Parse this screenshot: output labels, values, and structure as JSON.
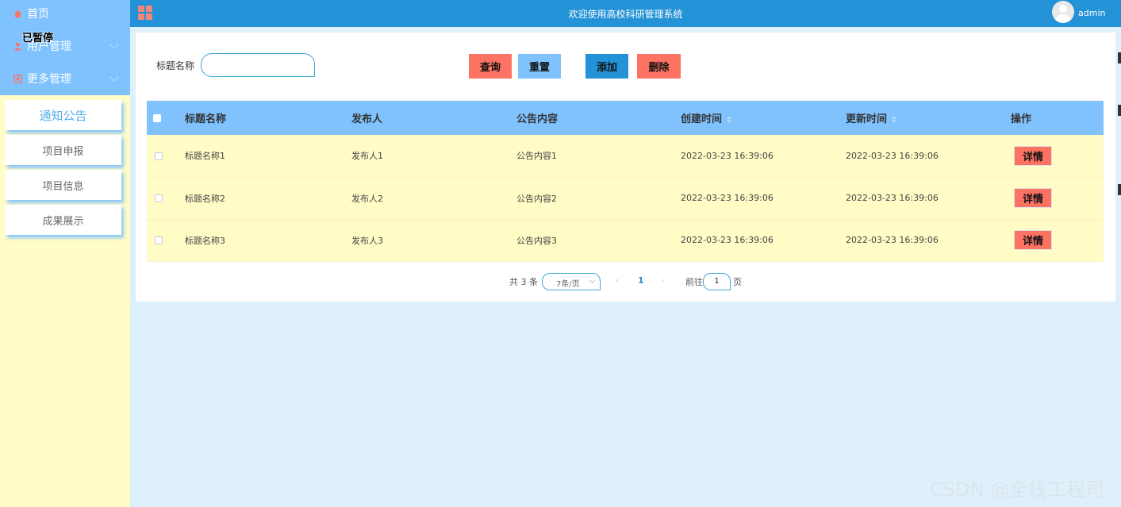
{
  "sidebar": {
    "top_items": [
      {
        "label": "首页",
        "icon": "home-icon"
      },
      {
        "label": "用户管理",
        "icon": "user-icon"
      },
      {
        "label": "更多管理",
        "icon": "more-icon"
      }
    ],
    "overlay_text": "已暂停",
    "sub_items": [
      {
        "label": "通知公告",
        "active": true
      },
      {
        "label": "项目申报",
        "active": false
      },
      {
        "label": "项目信息",
        "active": false
      },
      {
        "label": "成果展示",
        "active": false
      }
    ]
  },
  "header": {
    "title": "欢迎使用高校科研管理系统",
    "user": "admin"
  },
  "search": {
    "label": "标题名称",
    "value": ""
  },
  "toolbar": {
    "query": "查询",
    "reset": "重置",
    "add": "添加",
    "delete": "删除"
  },
  "table": {
    "headers": [
      "标题名称",
      "发布人",
      "公告内容",
      "创建时间",
      "更新时间",
      "操作"
    ],
    "rows": [
      {
        "title": "标题名称1",
        "publisher": "发布人1",
        "content": "公告内容1",
        "created": "2022-03-23 16:39:06",
        "updated": "2022-03-23 16:39:06",
        "action": "详情"
      },
      {
        "title": "标题名称2",
        "publisher": "发布人2",
        "content": "公告内容2",
        "created": "2022-03-23 16:39:06",
        "updated": "2022-03-23 16:39:06",
        "action": "详情"
      },
      {
        "title": "标题名称3",
        "publisher": "发布人3",
        "content": "公告内容3",
        "created": "2022-03-23 16:39:06",
        "updated": "2022-03-23 16:39:06",
        "action": "详情"
      }
    ]
  },
  "pagination": {
    "total": "共 3 条",
    "page_size": "7条/页",
    "prev": "‹",
    "current": "1",
    "next": "›",
    "goto_label": "前往",
    "goto_value": "1",
    "goto_unit": "页"
  },
  "watermark": "CSDN @全栈工程司",
  "colors": {
    "primary": "#2492d6",
    "light_blue": "#7fc2fe",
    "danger": "#fd7363",
    "row_bg": "#fffcc6",
    "page_bg": "#dff0fd"
  }
}
